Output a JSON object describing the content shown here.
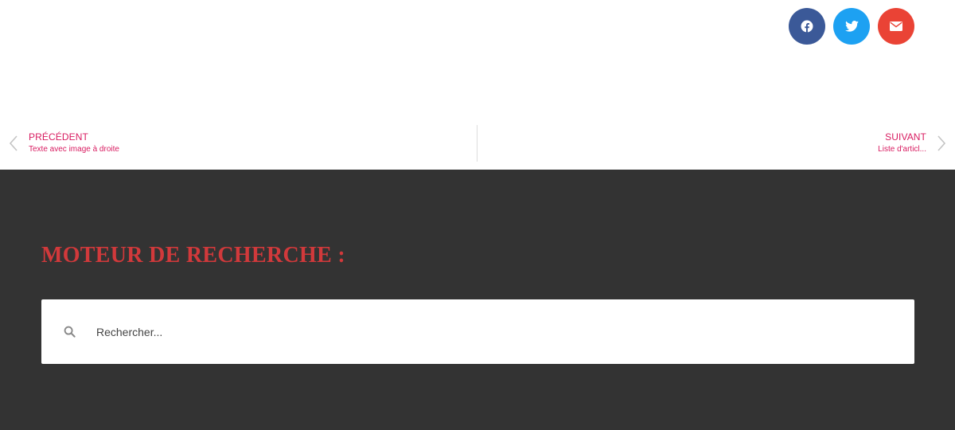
{
  "share": {
    "buttons": [
      {
        "name": "facebook",
        "icon": "facebook-icon",
        "color": "#3b5998"
      },
      {
        "name": "twitter",
        "icon": "twitter-icon",
        "color": "#1da1f2"
      },
      {
        "name": "email",
        "icon": "envelope-icon",
        "color": "#ea4335"
      }
    ]
  },
  "post_nav": {
    "prev": {
      "label": "PRÉCÉDENT",
      "title": "Texte avec image à droite",
      "icon": "chevron-left-icon"
    },
    "next": {
      "label": "SUIVANT",
      "title": "Liste d'articl...",
      "icon": "chevron-right-icon"
    },
    "accent_color": "#d81b60"
  },
  "footer": {
    "heading": "MOTEUR DE RECHERCHE :",
    "heading_color": "#d1393b",
    "background": "#333333",
    "search": {
      "placeholder": "Rechercher...",
      "value": "",
      "icon": "search-icon"
    }
  }
}
